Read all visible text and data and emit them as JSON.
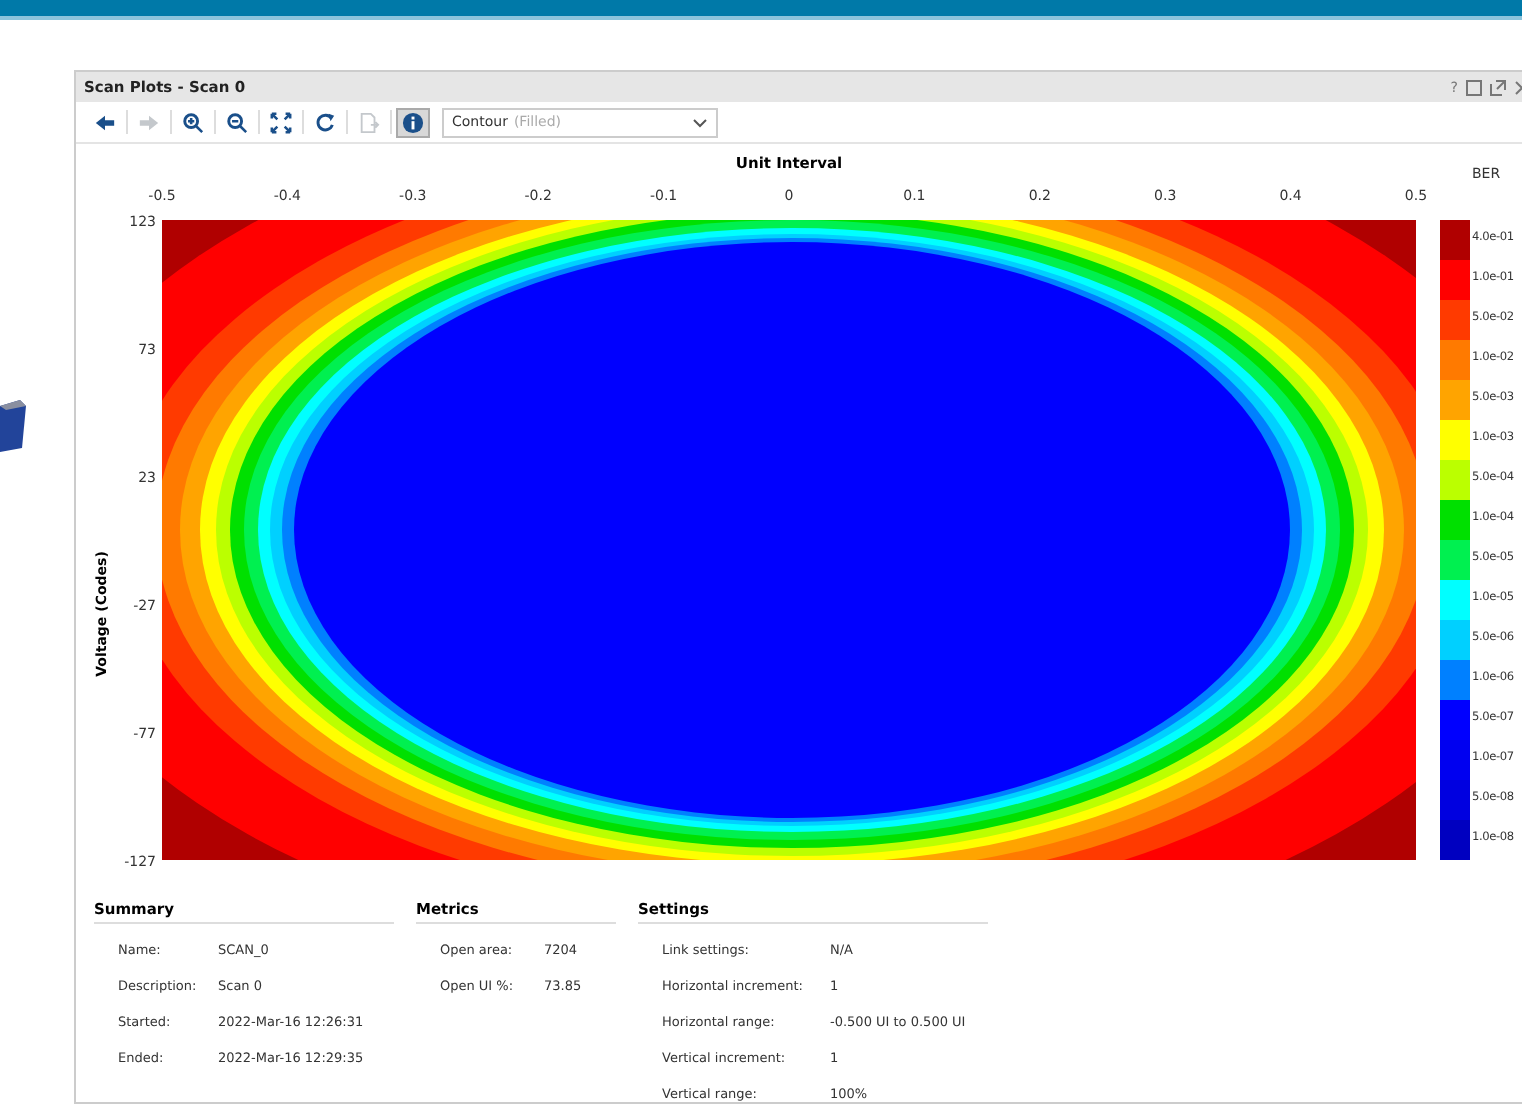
{
  "window": {
    "title": "Scan Plots - Scan 0",
    "help": "?"
  },
  "toolbar": {
    "buttons": [
      {
        "kind": "back",
        "disabled": false,
        "selected": false
      },
      {
        "kind": "forward",
        "disabled": true,
        "selected": false
      },
      {
        "kind": "zoom-in",
        "disabled": false,
        "selected": false
      },
      {
        "kind": "zoom-out",
        "disabled": false,
        "selected": false
      },
      {
        "kind": "fit",
        "disabled": false,
        "selected": false
      },
      {
        "kind": "refresh",
        "disabled": false,
        "selected": false
      },
      {
        "kind": "export",
        "disabled": true,
        "selected": false
      },
      {
        "kind": "info",
        "disabled": false,
        "selected": true
      }
    ],
    "plot_type": {
      "value": "Contour",
      "hint": "(Filled)"
    }
  },
  "plot": {
    "title": "Unit Interval",
    "y_label": "Voltage (Codes)",
    "x_ticks": [
      "-0.5",
      "-0.4",
      "-0.3",
      "-0.2",
      "-0.1",
      "0",
      "0.1",
      "0.2",
      "0.3",
      "0.4",
      "0.5"
    ],
    "y_ticks": [
      "123",
      "73",
      "23",
      "-27",
      "-77",
      "-127"
    ],
    "legend": {
      "title": "BER",
      "levels": [
        {
          "label": "4.0e-01",
          "color": "#b00000"
        },
        {
          "label": "1.0e-01",
          "color": "#ff0000"
        },
        {
          "label": "5.0e-02",
          "color": "#ff3a00"
        },
        {
          "label": "1.0e-02",
          "color": "#ff7a00"
        },
        {
          "label": "5.0e-03",
          "color": "#ffa400"
        },
        {
          "label": "1.0e-03",
          "color": "#ffff00"
        },
        {
          "label": "5.0e-04",
          "color": "#bbff00"
        },
        {
          "label": "1.0e-04",
          "color": "#00e000"
        },
        {
          "label": "5.0e-05",
          "color": "#00f050"
        },
        {
          "label": "1.0e-05",
          "color": "#00ffff"
        },
        {
          "label": "5.0e-06",
          "color": "#00d0ff"
        },
        {
          "label": "1.0e-06",
          "color": "#0080ff"
        },
        {
          "label": "5.0e-07",
          "color": "#0000ff"
        },
        {
          "label": "1.0e-07",
          "color": "#0000f0"
        },
        {
          "label": "5.0e-08",
          "color": "#0000e0"
        },
        {
          "label": "1.0e-08",
          "color": "#0000c0"
        }
      ]
    }
  },
  "sections": [
    {
      "title": "Summary",
      "rows": [
        {
          "label": "Name:",
          "value": "SCAN_0"
        },
        {
          "label": "Description:",
          "value": "Scan 0"
        },
        {
          "label": "Started:",
          "value": "2022-Mar-16 12:26:31"
        },
        {
          "label": "Ended:",
          "value": "2022-Mar-16 12:29:35"
        }
      ]
    },
    {
      "title": "Metrics",
      "rows": [
        {
          "label": "Open area:",
          "value": "7204"
        },
        {
          "label": "Open UI %:",
          "value": "73.85"
        }
      ]
    },
    {
      "title": "Settings",
      "rows": [
        {
          "label": "Link settings:",
          "value": "N/A"
        },
        {
          "label": "Horizontal increment:",
          "value": "1"
        },
        {
          "label": "Horizontal range:",
          "value": "-0.500 UI to 0.500 UI"
        },
        {
          "label": "Vertical increment:",
          "value": "1"
        },
        {
          "label": "Vertical range:",
          "value": "100%"
        }
      ]
    }
  ]
}
